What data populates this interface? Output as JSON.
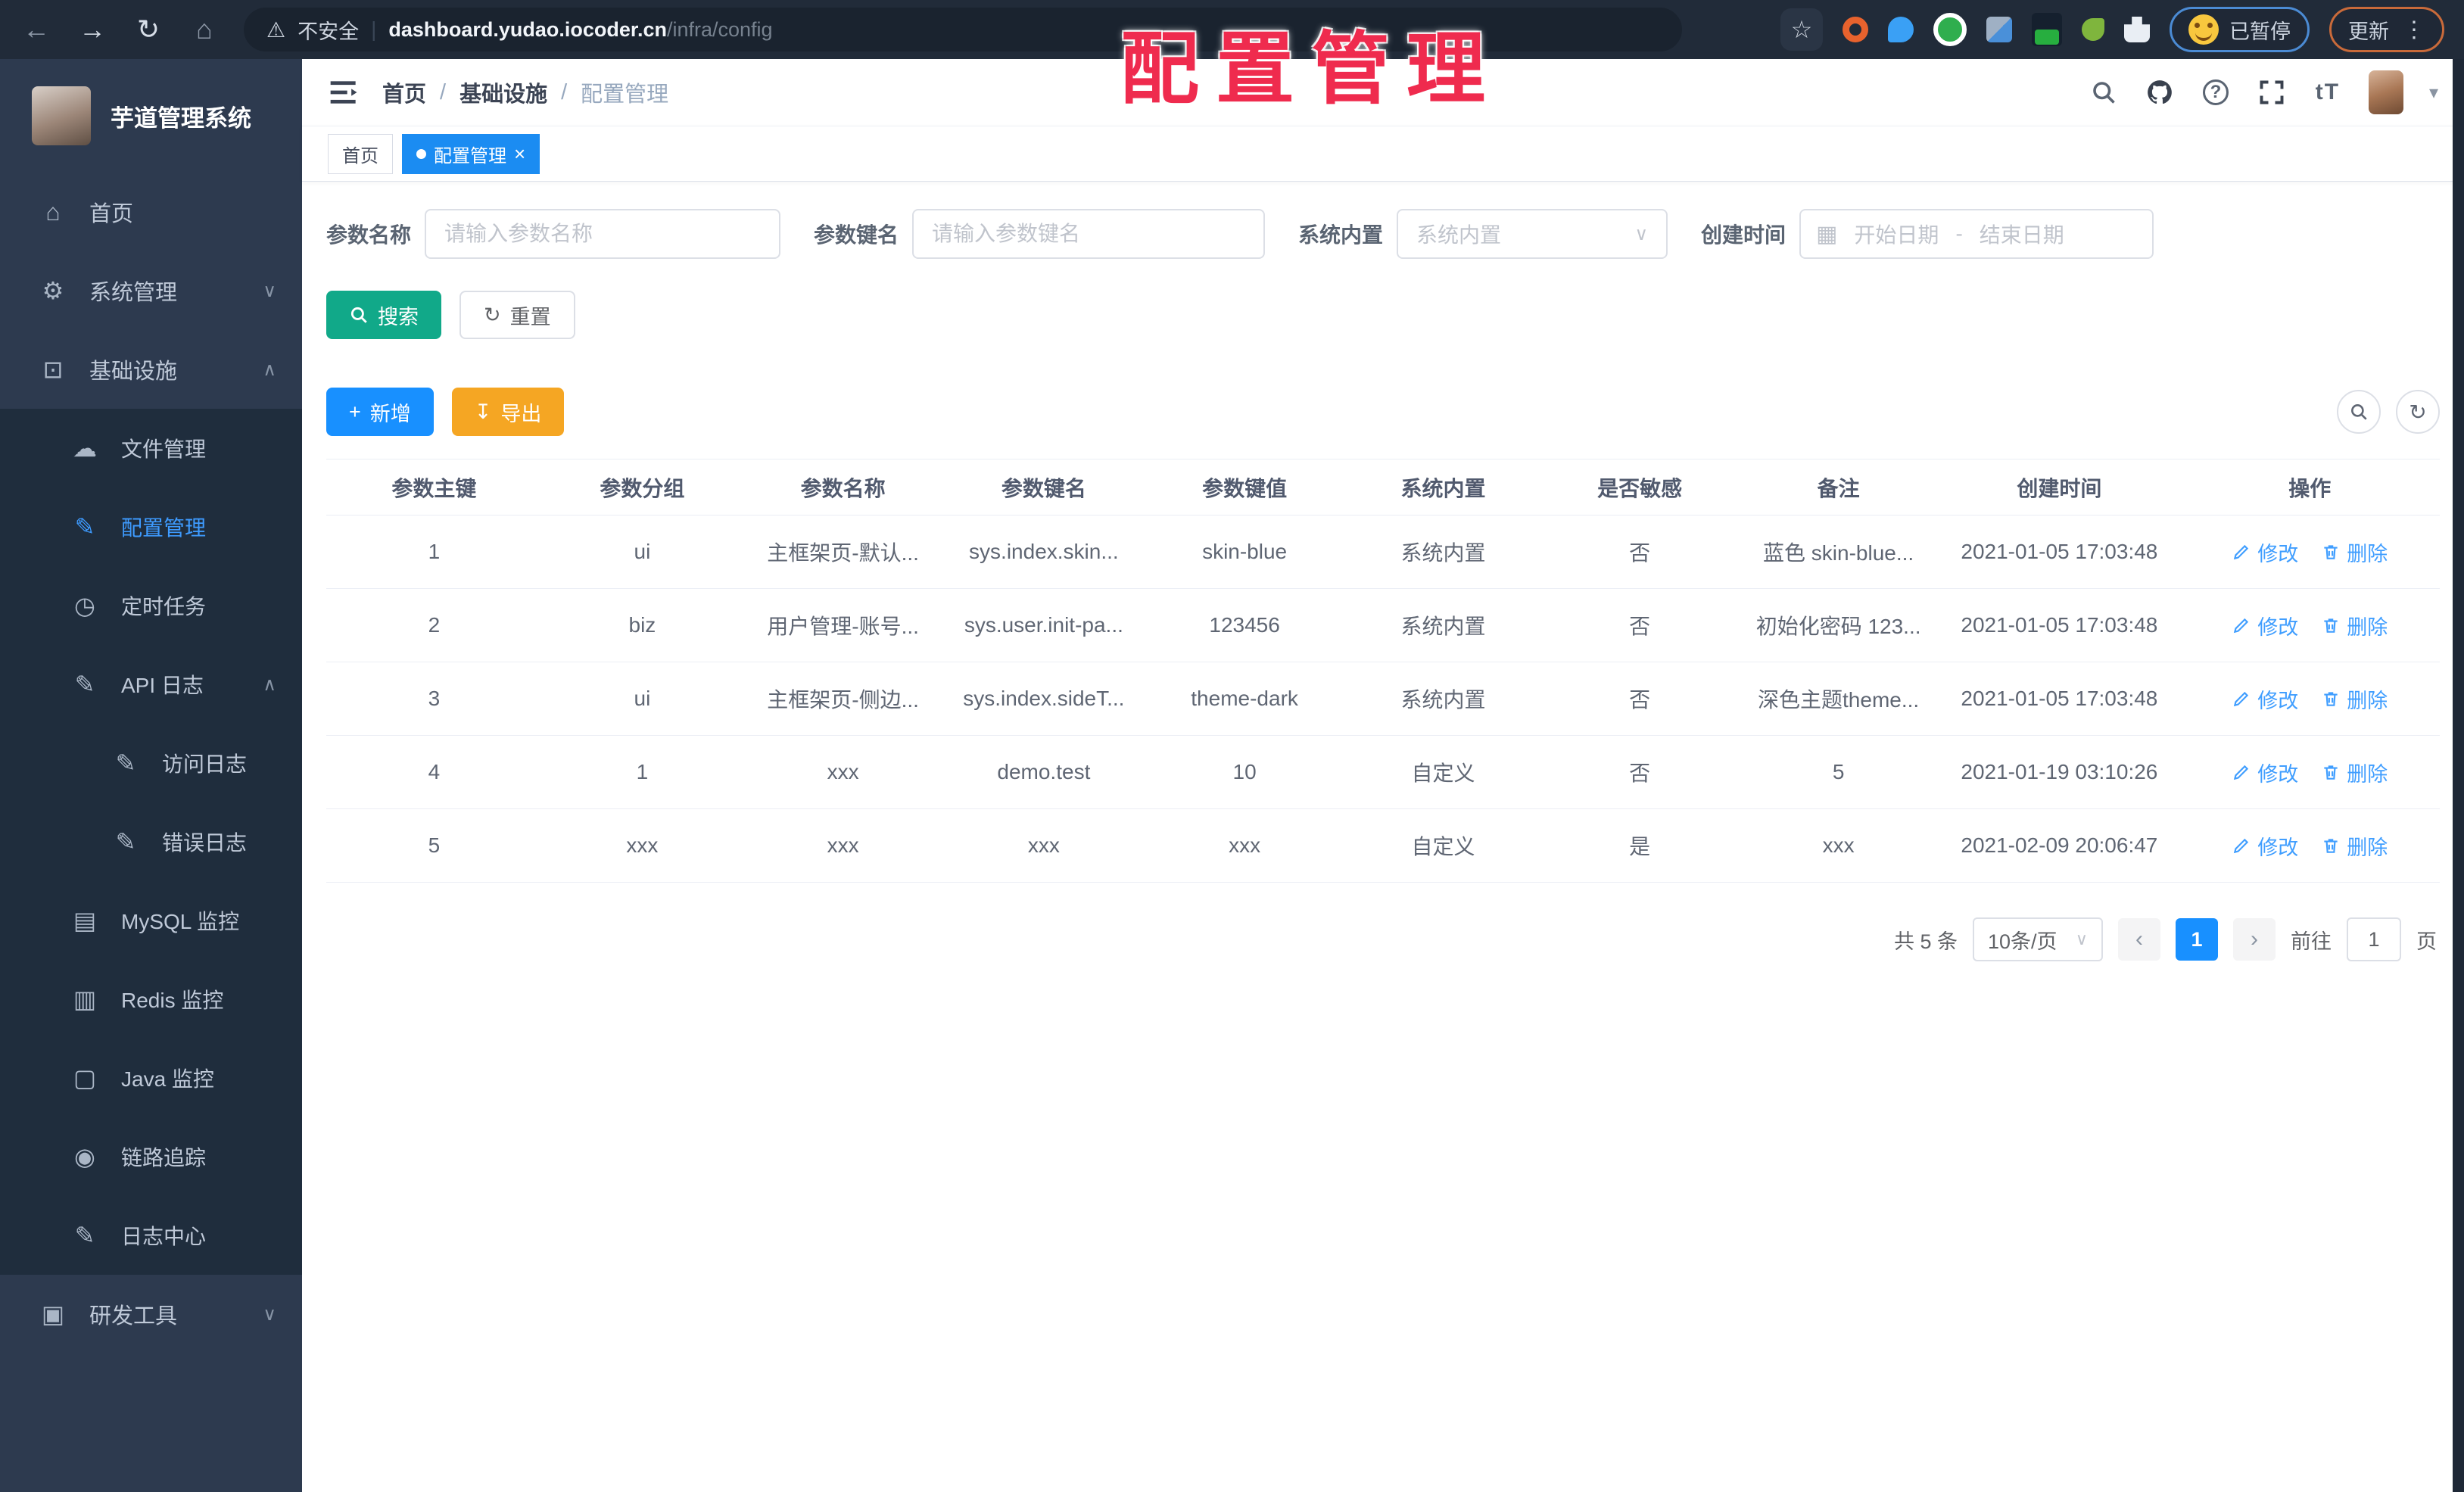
{
  "browser": {
    "security_label": "不安全",
    "url_host": "dashboard.yudao.iocoder.cn",
    "url_path": "/infra/config",
    "paused_badge": "已暂停",
    "update_button": "更新"
  },
  "stamp": "配置管理",
  "icons": {
    "back": "←",
    "forward": "→",
    "reload": "↻",
    "home": "⌂",
    "warning": "⚠",
    "star": "☆",
    "dots": "⋮",
    "menu_home": "⌂",
    "gear": "⚙",
    "monitor": "⊡",
    "cloud": "☁",
    "edit": "✎",
    "clock": "◷",
    "db": "▤",
    "layers": "▥",
    "java": "▢",
    "eye": "◉",
    "tool": "▣",
    "chev_down": "∨",
    "chev_up": "∧",
    "question": "?",
    "text_size": "tT",
    "caret_down": "▾",
    "plus": "+",
    "download": "↧",
    "refresh": "↻",
    "close": "×",
    "calendar": "▦",
    "select_caret": "∨",
    "prev": "‹",
    "next": "›"
  },
  "sidebar": {
    "app_title": "芋道管理系统",
    "home": "首页",
    "system": "系统管理",
    "infra": "基础设施",
    "file": "文件管理",
    "config": "配置管理",
    "job": "定时任务",
    "api_log": "API 日志",
    "access_log": "访问日志",
    "error_log": "错误日志",
    "mysql": "MySQL 监控",
    "redis": "Redis 监控",
    "java": "Java 监控",
    "trace": "链路追踪",
    "log_center": "日志中心",
    "dev_tool": "研发工具"
  },
  "breadcrumb": {
    "home": "首页",
    "parent": "基础设施",
    "current": "配置管理",
    "separator": "/"
  },
  "tags": {
    "home": "首页",
    "active": "配置管理"
  },
  "filter": {
    "name_label": "参数名称",
    "name_placeholder": "请输入参数名称",
    "key_label": "参数键名",
    "key_placeholder": "请输入参数键名",
    "builtin_label": "系统内置",
    "builtin_placeholder": "系统内置",
    "date_label": "创建时间",
    "date_start": "开始日期",
    "date_separator": "-",
    "date_end": "结束日期",
    "search_button": "搜索",
    "reset_button": "重置"
  },
  "toolbar": {
    "add_button": "新增",
    "export_button": "导出"
  },
  "table": {
    "columns": [
      "参数主键",
      "参数分组",
      "参数名称",
      "参数键名",
      "参数键值",
      "系统内置",
      "是否敏感",
      "备注",
      "创建时间",
      "操作"
    ],
    "edit_label": "修改",
    "delete_label": "删除",
    "rows": [
      {
        "id": "1",
        "group": "ui",
        "name": "主框架页-默认...",
        "key": "sys.index.skin...",
        "value": "skin-blue",
        "builtin": "系统内置",
        "sensitive": "否",
        "remark": "蓝色 skin-blue...",
        "created": "2021-01-05 17:03:48"
      },
      {
        "id": "2",
        "group": "biz",
        "name": "用户管理-账号...",
        "key": "sys.user.init-pa...",
        "value": "123456",
        "builtin": "系统内置",
        "sensitive": "否",
        "remark": "初始化密码 123...",
        "created": "2021-01-05 17:03:48"
      },
      {
        "id": "3",
        "group": "ui",
        "name": "主框架页-侧边...",
        "key": "sys.index.sideT...",
        "value": "theme-dark",
        "builtin": "系统内置",
        "sensitive": "否",
        "remark": "深色主题theme...",
        "created": "2021-01-05 17:03:48"
      },
      {
        "id": "4",
        "group": "1",
        "name": "xxx",
        "key": "demo.test",
        "value": "10",
        "builtin": "自定义",
        "sensitive": "否",
        "remark": "5",
        "created": "2021-01-19 03:10:26"
      },
      {
        "id": "5",
        "group": "xxx",
        "name": "xxx",
        "key": "xxx",
        "value": "xxx",
        "builtin": "自定义",
        "sensitive": "是",
        "remark": "xxx",
        "created": "2021-02-09 20:06:47"
      }
    ]
  },
  "pagination": {
    "total": "共 5 条",
    "size": "10条/页",
    "page": "1",
    "goto_label": "前往",
    "goto_value": "1",
    "unit": "页"
  }
}
